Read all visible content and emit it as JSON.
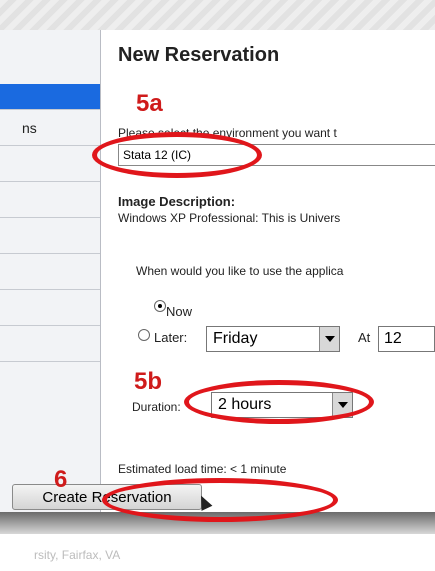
{
  "page": {
    "title": "New Reservation"
  },
  "sidebar": {
    "items": [
      {
        "label": "",
        "active": true
      },
      {
        "label": "ns",
        "active": false
      },
      {
        "label": "",
        "active": false
      },
      {
        "label": "",
        "active": false
      },
      {
        "label": "",
        "active": false
      },
      {
        "label": "",
        "active": false
      },
      {
        "label": "",
        "active": false
      },
      {
        "label": "",
        "active": false
      }
    ]
  },
  "environment": {
    "prompt": "Please select the environment you want t",
    "selected": "Stata 12 (IC)"
  },
  "image_description": {
    "heading": "Image Description:",
    "text": "Windows XP Professional: This is Univers"
  },
  "schedule": {
    "question": "When would you like to use the applica",
    "now_label": "Now",
    "later_label": "Later:",
    "day": "Friday",
    "at_label": "At",
    "time": "12",
    "selected_option": "Now"
  },
  "duration": {
    "label": "Duration:",
    "value": "2 hours"
  },
  "estimate": "Estimated load time: < 1 minute",
  "create_button": "Create Reservation",
  "footer": "rsity, Fairfax, VA",
  "annotations": {
    "a": "5a",
    "b": "5b",
    "c": "6",
    "color": "#cf1b1b"
  }
}
